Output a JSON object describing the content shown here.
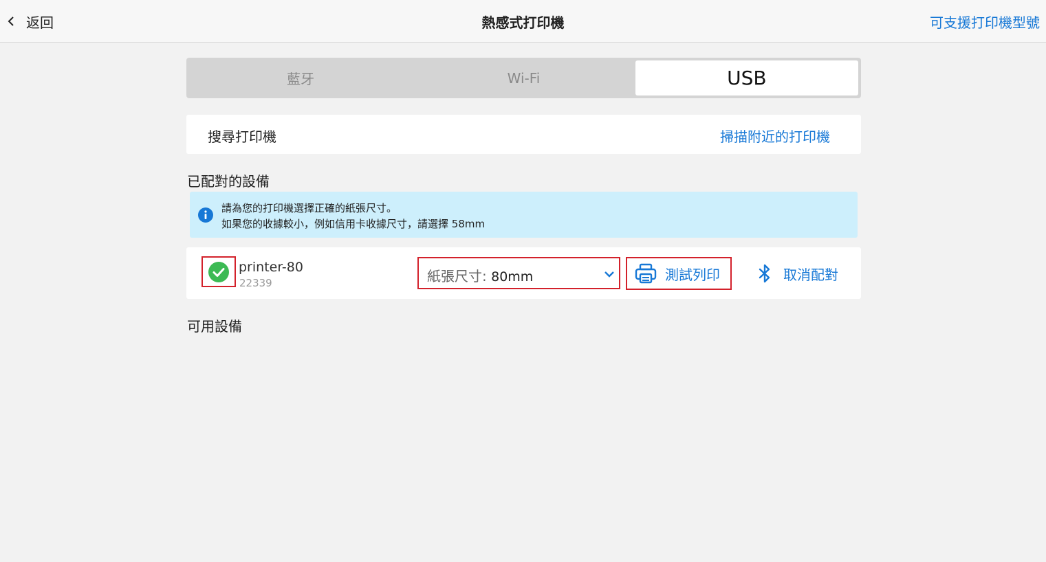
{
  "header": {
    "back_label": "返回",
    "title": "熱感式打印機",
    "supported_models_link": "可支援打印機型號"
  },
  "connection_tabs": {
    "items": [
      {
        "label": "藍牙",
        "active": false
      },
      {
        "label": "Wi-Fi",
        "active": false
      },
      {
        "label": "USB",
        "active": true
      }
    ]
  },
  "search": {
    "label": "搜尋打印機",
    "scan_link": "掃描附近的打印機"
  },
  "paired_section": {
    "title": "已配對的設備",
    "info_line1": "請為您的打印機選擇正確的紙張尺寸。",
    "info_line2": "如果您的收據較小，例如信用卡收據尺寸，請選擇 58mm",
    "devices": [
      {
        "name": "printer-80",
        "id": "22339",
        "paper_size_label": "紙張尺寸:",
        "paper_size_value": "80mm",
        "test_print_label": "測試列印",
        "unpair_label": "取消配對"
      }
    ]
  },
  "available_section": {
    "title": "可用設備"
  },
  "colors": {
    "accent": "#1778d6",
    "highlight_border": "#d3212b",
    "success": "#3cba54",
    "info_bg": "#cdeffc"
  },
  "icons": {
    "back": "chevron-left-icon",
    "info": "info-icon",
    "status": "check-circle-icon",
    "dropdown": "chevron-down-icon",
    "print": "printer-icon",
    "unpair": "bluetooth-icon"
  }
}
